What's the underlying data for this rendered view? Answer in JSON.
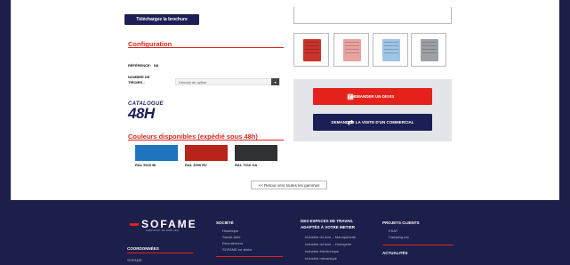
{
  "product": {
    "brochure_label": "Téléchargez la brochure",
    "configuration_title": "Configuration",
    "reference_label": "RÉFÉRENCE:",
    "reference_value": "N8",
    "drawers_label_1": "NOMBRE DE",
    "drawers_label_2": "TIROIRS :",
    "drawers_select_placeholder": "Choose an option",
    "catalogue_top": "CATALOGUE",
    "catalogue_big": "48H",
    "colors_title": "Couleurs disponibles (expédié sous 48h)",
    "colors": [
      {
        "label": "RAL 5010 Bl",
        "hex": "#1f74c0"
      },
      {
        "label": "RAL 3000 RV",
        "hex": "#b8231c"
      },
      {
        "label": "RAL 7016 GA",
        "hex": "#2e3233"
      }
    ],
    "back_label": "<< Retour vers toutes les gammes"
  },
  "actions": {
    "devis_label": "DEMANDER UN DEVIS",
    "visite_label": "DEMANDER LA VISITE D'UN COMMERCIAL"
  },
  "thumbnails": [
    {
      "name": "equipped",
      "color": "#c9332b"
    },
    {
      "name": "red",
      "color": "#e8a3a0"
    },
    {
      "name": "blue",
      "color": "#9ec4e6"
    },
    {
      "name": "grey",
      "color": "#9da1a6"
    }
  ],
  "footer": {
    "logo": "SOFAME",
    "logo_sub": "FABRICANT DE MOBILIER",
    "coordonnees_title": "COORDONNÉES",
    "coordonnees_items": [
      "SOFAME"
    ],
    "societe_title": "SOCIÉTÉ",
    "societe_items": [
      "Historique",
      "Savoir-faire",
      "Recrutement",
      "SOFAME en vidéo"
    ],
    "espaces_title_1": "DES ESPACES DE TRAVAIL",
    "espaces_title_2": "ADAPTÉS À VOTRE METIER",
    "espaces_items": [
      "Industrie du luxe – Maroquinerie",
      "Industrie du luxe – Horlogerie",
      "Industrie électronique",
      "Industrie mécanique"
    ],
    "projets_title": "PROJETS CLIENTS",
    "projets_items": [
      "ESAT",
      "Camping-car"
    ],
    "actualites_title": "ACTUALITÉS"
  },
  "colors": {
    "accent_red": "#e4221b",
    "navy": "#1b1f55"
  }
}
